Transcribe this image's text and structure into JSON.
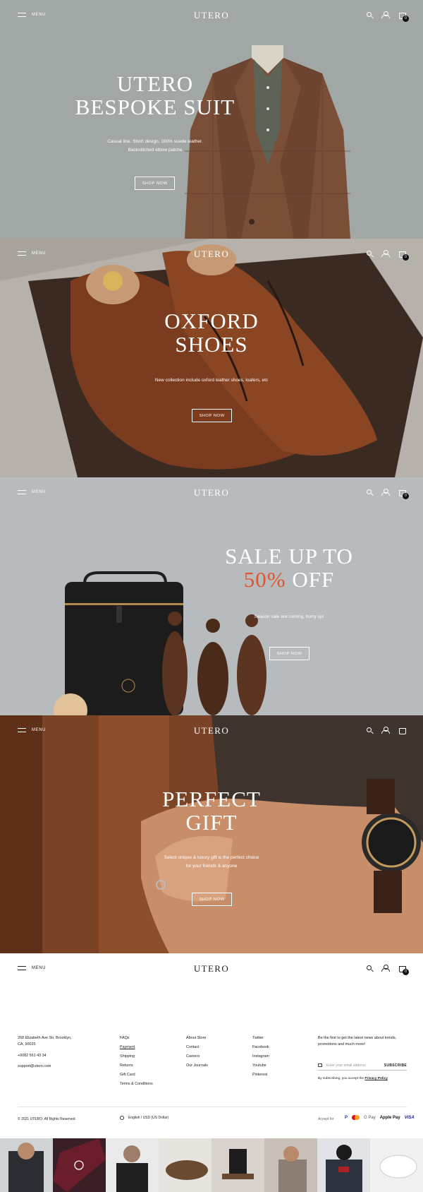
{
  "header": {
    "menu_label": "MENU",
    "logo": "UTERO",
    "cart_count": "0"
  },
  "hero_suit": {
    "title_line1": "UTERO",
    "title_line2": "BESPOKE SUIT",
    "subtitle_line1": "Casual line. Short design. 100% suede leather.",
    "subtitle_line2": "Backstitched elbow patche",
    "button": "SHOP NOW"
  },
  "hero_shoes": {
    "title_line1": "OXFORD",
    "title_line2": "SHOES",
    "subtitle": "New collection include oxford leather shoes, loafers, etc",
    "button": "SHOP NOW"
  },
  "hero_sale": {
    "title_line1": "SALE UP TO",
    "title_highlight": "50%",
    "title_rest": "OFF",
    "subtitle": "Season sale are coming, hurry up!",
    "button": "SHOP NOW",
    "accent_color": "#e0542e"
  },
  "hero_gift": {
    "title_line1": "PERFECT",
    "title_line2": "GIFT",
    "subtitle_line1": "Select unique & luxury gift is the perfect choice",
    "subtitle_line2": "for your friends & anyone",
    "button": "SHOP NOW"
  },
  "footer": {
    "address_line1": "268 Elizabeth Ave Str, Brooklyn,",
    "address_line2": "CA, 90025",
    "phone": "+0082 561 43 34",
    "email": "support@utero.com",
    "col1": [
      "FAQs",
      "Payment",
      "Shipping",
      "Returns",
      "Gift Card",
      "Terms & Conditions"
    ],
    "col2": [
      "About Store",
      "Contact",
      "Careers",
      "Our Journals"
    ],
    "col3": [
      "Twitter",
      "Facebook",
      "Instagram",
      "Youtube",
      "Pinterest"
    ],
    "newsletter_line1": "Be the first to get the latest news about trends,",
    "newsletter_line2": "promotions and much more!",
    "email_placeholder": "Enter your email address",
    "subscribe": "SUBSCRIBE",
    "consent_text": "By subscribing, you accept the",
    "privacy_link": "Privacy Policy",
    "copyright": "© 2021 UTERO. All Rights Reserved",
    "locale": "English / USD (US Dollar)",
    "accept_for": "Accept for",
    "payments": [
      "PayPal",
      "Mastercard",
      "G Pay",
      "Apple Pay",
      "VISA"
    ]
  },
  "colors": {
    "panel_suit": "#a1a7a4",
    "panel_sale": "#b7bbbe",
    "dark_text": "#222222",
    "light_text": "#ffffff"
  }
}
